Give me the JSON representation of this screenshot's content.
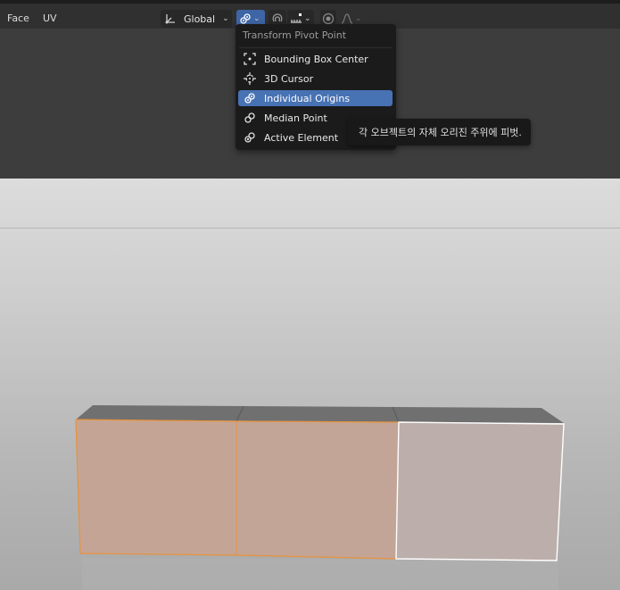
{
  "header": {
    "menu": [
      "Face",
      "UV"
    ],
    "orientation": {
      "label": "Global",
      "icon": "transform-orientation-icon"
    },
    "pivot_icon": "individual-origins-icon",
    "snap_icon": "snap-magnet-icon",
    "snap_target_icon": "snap-increment-icon",
    "proportional_icon": "proportional-editing-icon",
    "falloff_icon": "falloff-curve-icon"
  },
  "pivot_menu": {
    "title": "Transform Pivot Point",
    "items": [
      {
        "label": "Bounding Box Center",
        "icon": "bounding-box-center-icon",
        "selected": false
      },
      {
        "label": "3D Cursor",
        "icon": "3d-cursor-icon",
        "selected": false
      },
      {
        "label": "Individual Origins",
        "icon": "individual-origins-icon",
        "selected": true
      },
      {
        "label": "Median Point",
        "icon": "median-point-icon",
        "selected": false
      },
      {
        "label": "Active Element",
        "icon": "active-element-icon",
        "selected": false
      }
    ]
  },
  "tooltip": {
    "text": "각 오브젝트의 자체 오리진 주위에 피벗."
  },
  "colors": {
    "accent": "#4772b3",
    "selection_orange": "#e8923d",
    "active_white": "#ffffff"
  }
}
